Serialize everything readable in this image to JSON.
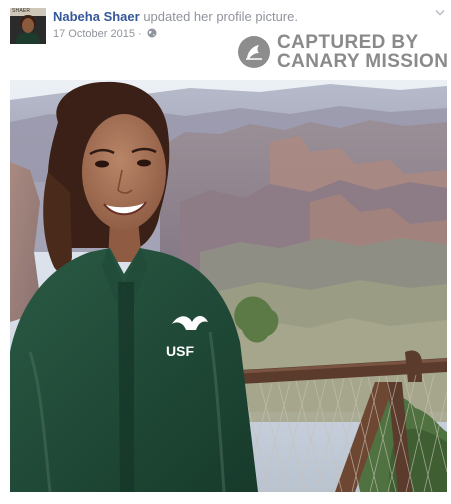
{
  "post": {
    "author_name": "Nabeha Shaer",
    "action_text": " updated her profile picture.",
    "date": "17 October 2015",
    "date_separator": " · ",
    "privacy_icon": "globe-icon",
    "menu_icon": "chevron-down-icon"
  },
  "avatar": {
    "label": "SHAER"
  },
  "watermark": {
    "line1": "CAPTURED BY",
    "line2": "CANARY MISSION",
    "logo_icon": "canary-bird-icon"
  },
  "photo": {
    "shirt_text": "USF"
  },
  "colors": {
    "link_blue": "#365899",
    "meta_grey": "#90949c",
    "watermark_grey": "#8a8a8a",
    "jacket_green": "#1f4a36"
  }
}
